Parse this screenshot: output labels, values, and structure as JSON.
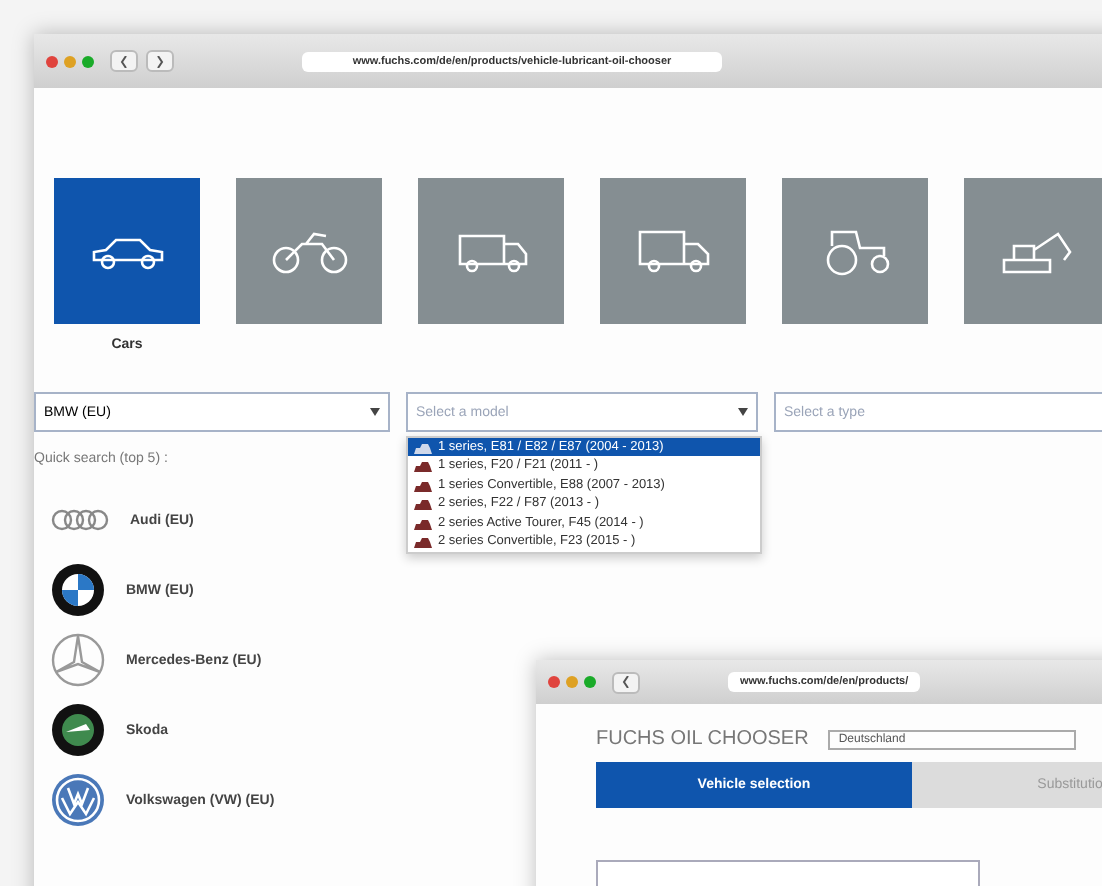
{
  "back_window": {
    "url": "www.fuchs.com/de/en/products/vehicle-lubricant-oil-chooser",
    "categories": [
      {
        "kind": "car",
        "label": "Cars",
        "selected": true
      },
      {
        "kind": "motorcycle",
        "selected": false
      },
      {
        "kind": "van",
        "selected": false
      },
      {
        "kind": "truck",
        "selected": false
      },
      {
        "kind": "tractor",
        "selected": false
      },
      {
        "kind": "excavator",
        "selected": false
      }
    ],
    "make_select": {
      "value": "BMW (EU)"
    },
    "model_select": {
      "placeholder": "Select a model"
    },
    "type_select": {
      "placeholder": "Select a type"
    },
    "model_options": [
      {
        "label": "1 series, E81 / E82 / E87 (2004 - 2013)",
        "selected": true
      },
      {
        "label": "1 series, F20 / F21 (2011 - )",
        "selected": false
      },
      {
        "label": "1 series Convertible, E88 (2007 - 2013)",
        "selected": false
      },
      {
        "label": "2 series, F22 / F87 (2013 - )",
        "selected": false
      },
      {
        "label": "2 series Active Tourer, F45 (2014 - )",
        "selected": false
      },
      {
        "label": "2 series Convertible, F23 (2015 - )",
        "selected": false
      }
    ],
    "quick_search_label": "Quick search (top 5) :",
    "brands": [
      {
        "kind": "audi",
        "name": "Audi (EU)"
      },
      {
        "kind": "bmw",
        "name": "BMW (EU)"
      },
      {
        "kind": "mercedes",
        "name": "Mercedes-Benz (EU)"
      },
      {
        "kind": "skoda",
        "name": "Skoda"
      },
      {
        "kind": "vw",
        "name": "Volkswagen (VW) (EU)"
      }
    ]
  },
  "front_window": {
    "url": "www.fuchs.com/de/en/products/",
    "title": "FUCHS OIL CHOOSER",
    "country_select": {
      "value": "Deutschland"
    },
    "tabs": [
      {
        "label": "Vehicle selection",
        "selected": true
      },
      {
        "label": "Substitutio",
        "selected": false
      }
    ]
  }
}
